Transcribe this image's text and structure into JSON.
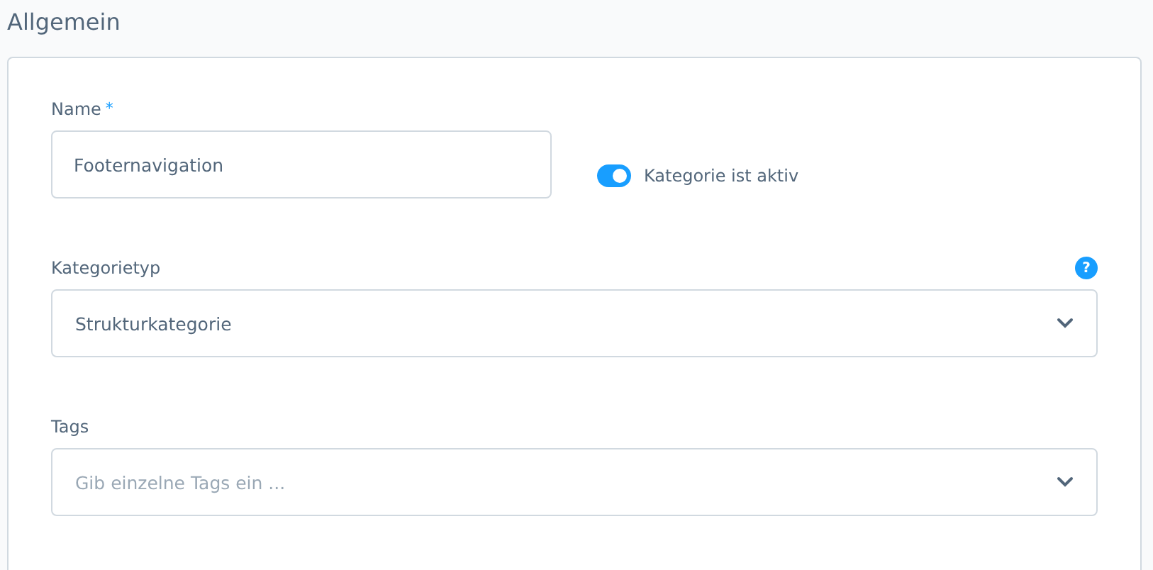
{
  "section": {
    "title": "Allgemein"
  },
  "name_field": {
    "label": "Name",
    "required_mark": "*",
    "value": "Footernavigation"
  },
  "active_toggle": {
    "label": "Kategorie ist aktiv",
    "on": true
  },
  "category_type": {
    "label": "Kategorietyp",
    "help": "?",
    "value": "Strukturkategorie"
  },
  "tags": {
    "label": "Tags",
    "placeholder": "Gib einzelne Tags ein ..."
  }
}
